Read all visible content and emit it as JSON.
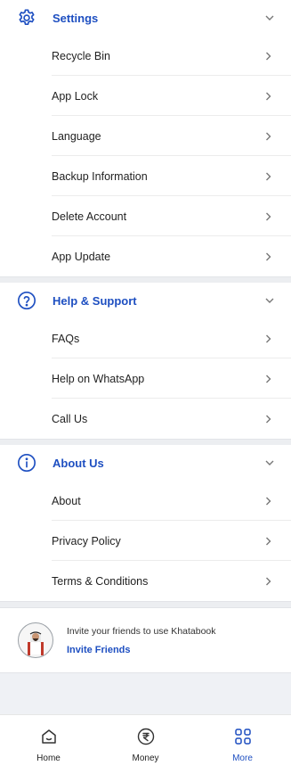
{
  "settings": {
    "title": "Settings",
    "items": [
      {
        "label": "Recycle Bin"
      },
      {
        "label": "App Lock"
      },
      {
        "label": "Language"
      },
      {
        "label": "Backup Information"
      },
      {
        "label": "Delete Account"
      },
      {
        "label": "App Update"
      }
    ]
  },
  "help": {
    "title": "Help & Support",
    "items": [
      {
        "label": "FAQs"
      },
      {
        "label": "Help on WhatsApp"
      },
      {
        "label": "Call Us"
      }
    ]
  },
  "about": {
    "title": "About Us",
    "items": [
      {
        "label": "About"
      },
      {
        "label": "Privacy Policy"
      },
      {
        "label": "Terms & Conditions"
      }
    ]
  },
  "invite": {
    "message": "Invite your friends to use Khatabook",
    "link_label": "Invite Friends"
  },
  "bottom_nav": [
    {
      "label": "Home",
      "icon": "home-icon",
      "active": false
    },
    {
      "label": "Money",
      "icon": "rupee-icon",
      "active": false
    },
    {
      "label": "More",
      "icon": "grid-icon",
      "active": true
    }
  ],
  "colors": {
    "accent": "#1e4fc1",
    "section_bg": "#eceef1"
  }
}
